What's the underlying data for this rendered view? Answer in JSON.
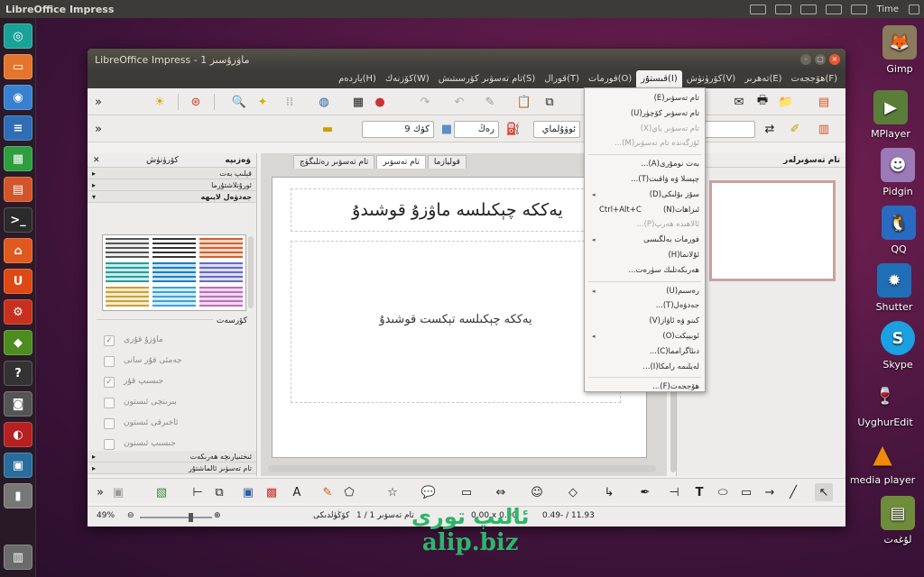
{
  "panel": {
    "title": "LibreOffice Impress",
    "time": "Time"
  },
  "window": {
    "title": "LibreOffice Impress - 1 ماۋزۇسىز"
  },
  "menubar": [
    "ھۆججەت(F)",
    "تەھرىر(E)",
    "كۆرۈنۈش(V)",
    "قىستۇر(I)",
    "فورمات(O)",
    "قورال(T)",
    "تام تەسۋىر كۆرسىتىش(S)",
    "كۆزنەك(W)",
    "ياردەم(H)"
  ],
  "toolbar2": {
    "font_combo": "ئوۋۇلماي",
    "font_size": "كۆك 9",
    "color_label": "رەڭ"
  },
  "sidebar": {
    "title": "كۆرۈنۈش",
    "pane_label": "ۋەزىپە",
    "sections": [
      "قېلىپ بەت",
      "ئورۇنلاشتۇرما",
      "جەدۋەل لايىھە"
    ],
    "group": "كۆرسەت",
    "options": [
      "ماۋزۇ قۇرى",
      "جەمئى قۇر سانى",
      "جىسىپ قۇر",
      "بىرىنچى ئىستون",
      "ئاخىرقى ئىستون",
      "جىسىپ ئىستون"
    ],
    "bottom_sections": [
      "ئىختىيارىچە ھەرىكەت",
      "تام تەسۋىر ئالماشتۇر"
    ]
  },
  "tabs": [
    "تام تەسۋىر رەتلىگۈچ",
    "تام تەسۋىر",
    "قوليازما"
  ],
  "slide": {
    "title": "يەككە چېكىلسە ماۋزۇ قوشىدۇ",
    "body": "يەككە چېكىلسە تېكست قوشىدۇ"
  },
  "right_pane": {
    "title": "تام تەسۋىرلەر"
  },
  "menu": {
    "items": [
      {
        "label": "تام تەسۋىر(E)",
        "dis": false
      },
      {
        "label": "تام تەسۋىر كۆچۈر(U)",
        "dis": false
      },
      {
        "label": "تام تەسۋىر ياي(X)",
        "dis": true
      },
      {
        "label": "ئۆزگەندە تام تەسۋىر(M)...",
        "dis": true
      },
      {
        "label": "بەت نومۇرى(A)...",
        "dis": false
      },
      {
        "label": "چېسلا ۋە ۋاقىت(T)...",
        "dis": false
      },
      {
        "label": "سۆز بۆلىكى(D)",
        "dis": false,
        "sub": true
      },
      {
        "label": "ئىزاھات(N)",
        "dis": false,
        "shortcut": "Ctrl+Alt+C"
      },
      {
        "label": "ئالاھىدە ھەرپ(P)...",
        "dis": true
      },
      {
        "label": "فورمات بەلگىسى",
        "dis": false,
        "sub": true
      },
      {
        "label": "ئۇلانما(H)",
        "dis": false
      },
      {
        "label": "ھەرىكەتلىك سۈرەت...",
        "dis": false
      },
      {
        "label": "رەسىم(U)",
        "dis": false,
        "sub": true
      },
      {
        "label": "جەدۋەل(T)...",
        "dis": false
      },
      {
        "label": "كىنو ۋە ئاۋاز(V)",
        "dis": false
      },
      {
        "label": "ئوبيېكت(O)",
        "dis": false,
        "sub": true
      },
      {
        "label": "دىئاگرامما(C)...",
        "dis": false
      },
      {
        "label": "لەيلىمە رامكا(I)...",
        "dis": false
      },
      {
        "label": "ھۆججەت(F)...",
        "dis": false
      }
    ]
  },
  "status": {
    "zoom": "49%",
    "slide": "تام تەسۋىر 1 / 1",
    "layout": "كۆڭۈلدىكى",
    "size": "0.00 x 0.00",
    "pos": "0.49- / 11.93"
  },
  "desktop": [
    "Gimp",
    "MPlayer",
    "Pidgin",
    "QQ",
    "Shutter",
    "Skype",
    "UyghurEdit",
    "media player",
    "لۇغەت"
  ],
  "watermark": {
    "line1": "ئالىپ تورى",
    "line2": "alip.biz"
  },
  "colors": {
    "panel": "#3c3b37",
    "accent": "#e8572f",
    "watermark": "#2db56a"
  }
}
